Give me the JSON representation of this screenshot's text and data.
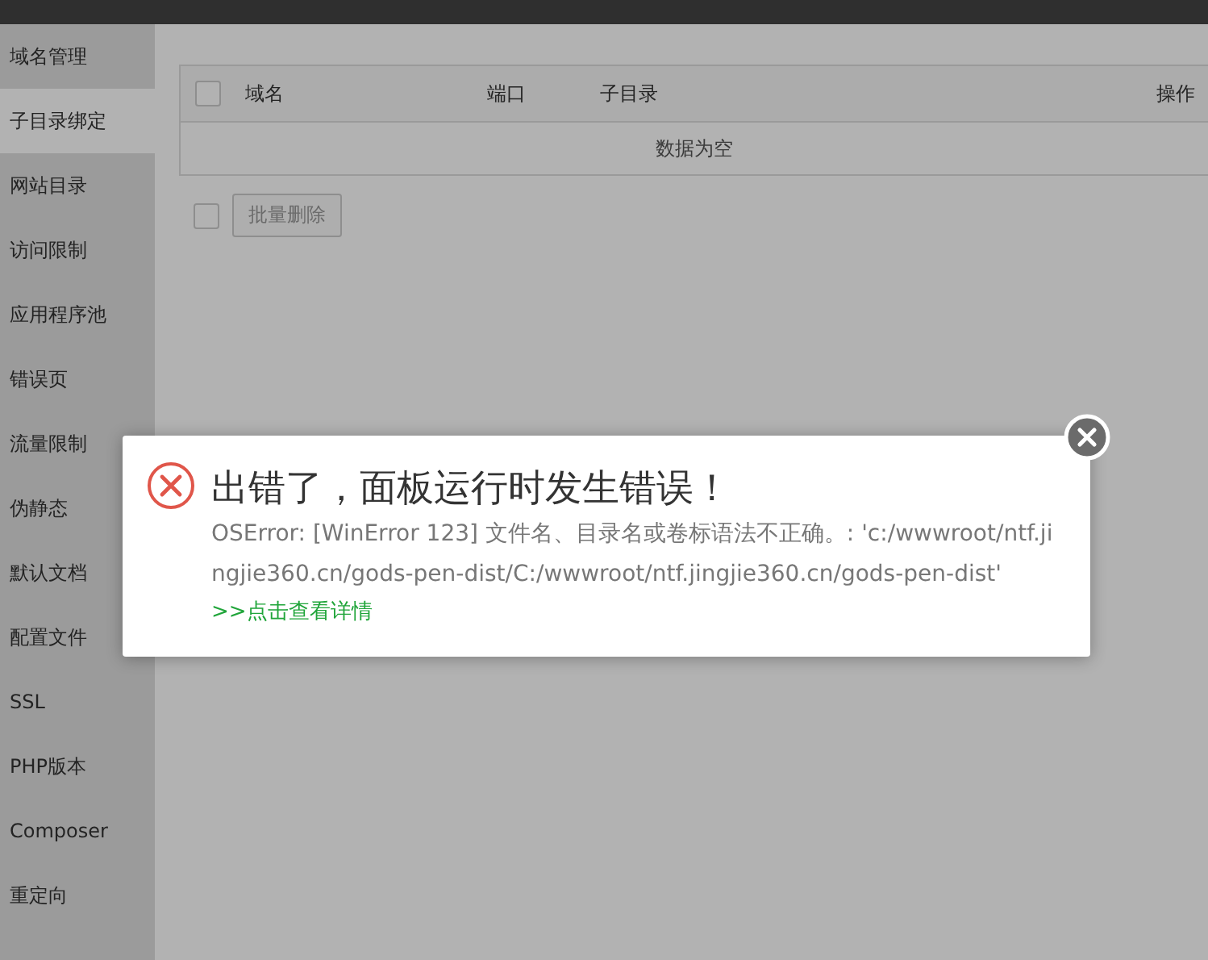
{
  "sidebar": {
    "items": [
      {
        "label": "域名管理",
        "selected": false
      },
      {
        "label": "子目录绑定",
        "selected": true
      },
      {
        "label": "网站目录",
        "selected": false
      },
      {
        "label": "访问限制",
        "selected": false
      },
      {
        "label": "应用程序池",
        "selected": false
      },
      {
        "label": "错误页",
        "selected": false
      },
      {
        "label": "流量限制",
        "selected": false
      },
      {
        "label": "伪静态",
        "selected": false
      },
      {
        "label": "默认文档",
        "selected": false
      },
      {
        "label": "配置文件",
        "selected": false
      },
      {
        "label": "SSL",
        "selected": false
      },
      {
        "label": "PHP版本",
        "selected": false
      },
      {
        "label": "Composer",
        "selected": false
      },
      {
        "label": "重定向",
        "selected": false
      }
    ]
  },
  "table": {
    "columns": [
      "域名",
      "端口",
      "子目录",
      "操作"
    ],
    "empty_text": "数据为空",
    "select_all_checked": false
  },
  "batch_checkbox_checked": false,
  "batch_delete_button": "批量删除",
  "dialog": {
    "title": "出错了，面板运行时发生错误！",
    "message": "OSError: [WinError 123] 文件名、目录名或卷标语法不正确。: 'c:/wwwroot/ntf.jingjie360.cn/gods-pen-dist/C:/wwwroot/ntf.jingjie360.cn/gods-pen-dist'",
    "details_link": ">>点击查看详情"
  }
}
